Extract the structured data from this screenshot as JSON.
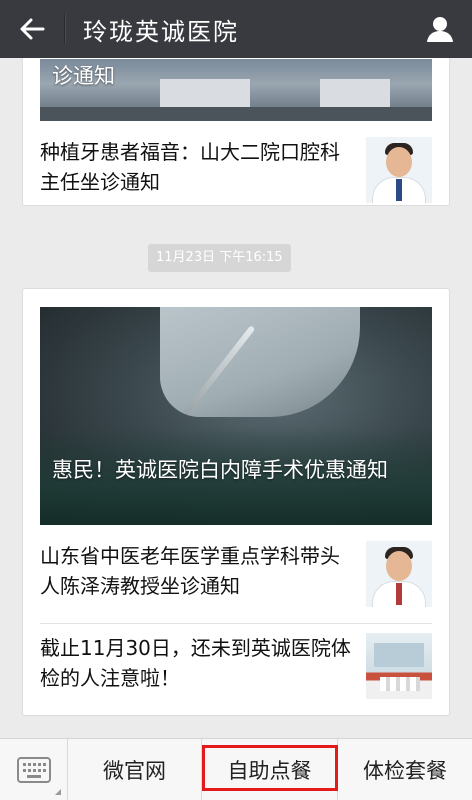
{
  "header": {
    "title": "玲珑英诚医院",
    "back_icon": "back-arrow-icon",
    "profile_icon": "person-icon"
  },
  "feed": {
    "card1": {
      "hero_caption": "诊通知",
      "items": [
        {
          "text": "种植牙患者福音：山大二院口腔科主任坐诊通知",
          "thumb": "doctor-photo"
        }
      ]
    },
    "timestamp": "11月23日 下午16:15",
    "card2": {
      "hero_caption": "惠民！英诚医院白内障手术优惠通知",
      "items": [
        {
          "text": "山东省中医老年医学重点学科带头人陈泽涛教授坐诊通知",
          "thumb": "doctor-photo"
        },
        {
          "text": "截止11月30日，还未到英诚医院体检的人注意啦！",
          "thumb": "hospital-photo"
        }
      ]
    }
  },
  "menu": {
    "keyboard_icon": "keyboard-icon",
    "items": [
      "微官网",
      "自助点餐",
      "体检套餐"
    ],
    "highlight_color": "#e31b1b"
  }
}
